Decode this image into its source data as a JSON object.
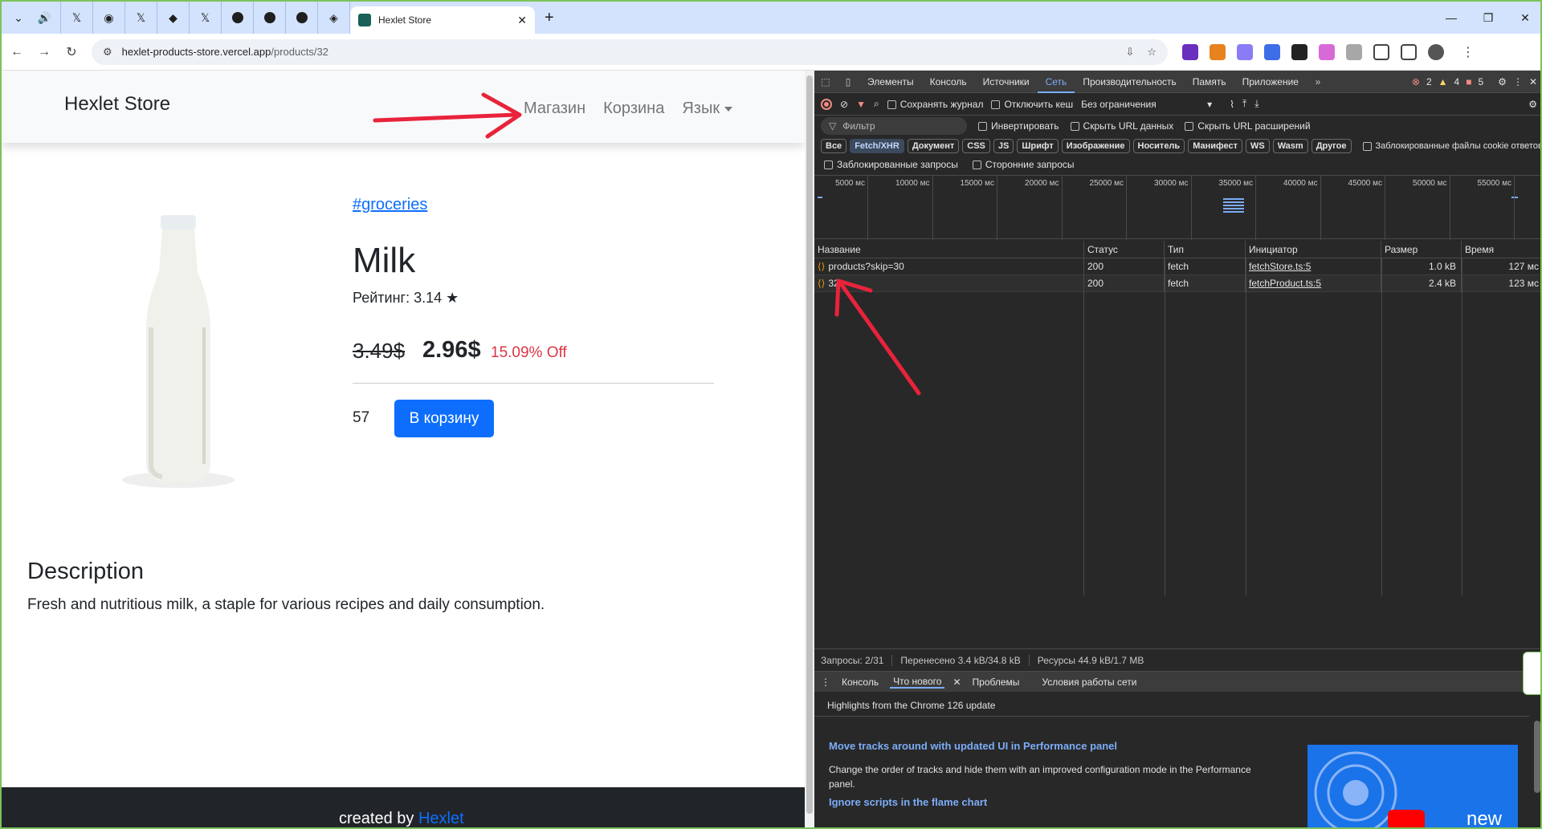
{
  "browser": {
    "active_tab_title": "Hexlet Store",
    "url_host": "hexlet-products-store.vercel.app",
    "url_path": "/products/32"
  },
  "store": {
    "brand": "Hexlet Store",
    "nav": {
      "shop": "Магазин",
      "cart": "Корзина",
      "language": "Язык"
    },
    "product": {
      "category_tag": "#groceries",
      "title": "Milk",
      "rating": "Рейтинг: 3.14 ★",
      "old_price": "3.49$",
      "new_price": "2.96$",
      "discount": "15.09% Off",
      "quantity": "57",
      "add_to_cart": "В корзину"
    },
    "description": {
      "heading": "Description",
      "text": "Fresh and nutritious milk, a staple for various recipes and daily consumption."
    },
    "footer": {
      "created_by": "created by ",
      "author": "Hexlet"
    }
  },
  "devtools": {
    "tabs": [
      "Элементы",
      "Консоль",
      "Источники",
      "Сеть",
      "Производительность",
      "Память",
      "Приложение"
    ],
    "active_tab": "Сеть",
    "badges": {
      "errors": "2",
      "warnings": "4",
      "issues": "5"
    },
    "toolbar": {
      "preserve_log": "Сохранять журнал",
      "disable_cache": "Отключить кеш",
      "throttling": "Без ограничения"
    },
    "filter": {
      "placeholder": "Фильтр",
      "invert": "Инвертировать",
      "hide_data_urls": "Скрыть URL данных",
      "hide_ext_urls": "Скрыть URL расширений",
      "types": [
        "Все",
        "Fetch/XHR",
        "Документ",
        "CSS",
        "JS",
        "Шрифт",
        "Изображение",
        "Носитель",
        "Манифест",
        "WS",
        "Wasm",
        "Другое"
      ],
      "selected_type": "Fetch/XHR",
      "blocked_cookies": "Заблокированные файлы cookie ответов",
      "blocked_requests": "Заблокированные запросы",
      "third_party": "Сторонние запросы"
    },
    "timeline_ticks": [
      "5000 мс",
      "10000 мс",
      "15000 мс",
      "20000 мс",
      "25000 мс",
      "30000 мс",
      "35000 мс",
      "40000 мс",
      "45000 мс",
      "50000 мс",
      "55000 мс"
    ],
    "columns": {
      "name": "Название",
      "status": "Статус",
      "type": "Тип",
      "initiator": "Инициатор",
      "size": "Размер",
      "time": "Время"
    },
    "requests": [
      {
        "name": "products?skip=30",
        "status": "200",
        "type": "fetch",
        "initiator": "fetchStore.ts:5",
        "size": "1.0 kB",
        "time": "127 мс"
      },
      {
        "name": "32",
        "status": "200",
        "type": "fetch",
        "initiator": "fetchProduct.ts:5",
        "size": "2.4 kB",
        "time": "123 мс"
      }
    ],
    "summary": {
      "requests": "Запросы: 2/31",
      "transferred": "Перенесено 3.4 kB/34.8 kB",
      "resources": "Ресурсы 44.9 kB/1.7 MB"
    },
    "drawer": {
      "tabs": [
        "Консоль",
        "Что нового",
        "Проблемы",
        "Условия работы сети"
      ],
      "active": "Что нового",
      "highlights": "Highlights from the Chrome 126 update",
      "item1_title": "Move tracks around with updated UI in Performance panel",
      "item1_desc": "Change the order of tracks and hide them with an improved configuration mode in the Performance panel.",
      "item2_title": "Ignore scripts in the flame chart",
      "video_label": "new"
    }
  }
}
